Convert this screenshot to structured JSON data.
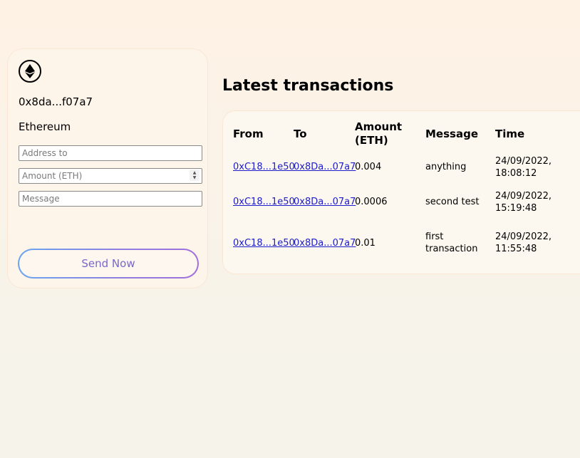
{
  "wallet": {
    "logo_icon": "ethereum-icon",
    "address": "0x8da...f07a7",
    "network": "Ethereum",
    "address_to_placeholder": "Address to",
    "amount_placeholder": "Amount (ETH)",
    "message_placeholder": "Message",
    "send_label": "Send Now"
  },
  "transactions": {
    "title": "Latest transactions",
    "headers": {
      "from": "From",
      "to": "To",
      "amount_line1": "Amount",
      "amount_line2": "(ETH)",
      "message": "Message",
      "time": "Time"
    },
    "rows": [
      {
        "from": "0xC18...1e50",
        "to": "0x8Da...07a7",
        "amount": "0.004",
        "message_line1": "anything",
        "message_line2": "",
        "time_line1": "24/09/2022,",
        "time_line2": "18:08:12"
      },
      {
        "from": "0xC18...1e50",
        "to": "0x8Da...07a7",
        "amount": "0.0006",
        "message_line1": "second test",
        "message_line2": "",
        "time_line1": "24/09/2022,",
        "time_line2": "15:19:48"
      },
      {
        "from": "0xC18...1e50",
        "to": "0x8Da...07a7",
        "amount": "0.01",
        "message_line1": "first",
        "message_line2": "transaction",
        "time_line1": "24/09/2022,",
        "time_line2": "11:55:48"
      }
    ]
  },
  "colors": {
    "background_top": "#fef2e4",
    "background_bottom": "#f5f3ea",
    "button_gradient_start": "#6aa5f0",
    "button_gradient_end": "#a36fdb",
    "link": "#1c1cc9"
  }
}
